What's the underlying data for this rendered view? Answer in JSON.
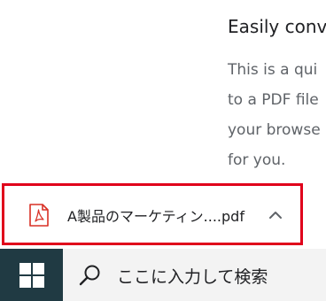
{
  "article": {
    "heading": "Easily conv",
    "lines": [
      "This is a qui",
      "to a PDF file",
      "your browse",
      "for you."
    ]
  },
  "download": {
    "file_name": "A製品のマーケティン....pdf",
    "file_icon": "pdf-icon",
    "expand_icon": "chevron-up-icon",
    "highlight_color": "#e0001b"
  },
  "taskbar": {
    "start_icon": "windows-logo-icon",
    "search_placeholder": "ここに入力して検索"
  }
}
